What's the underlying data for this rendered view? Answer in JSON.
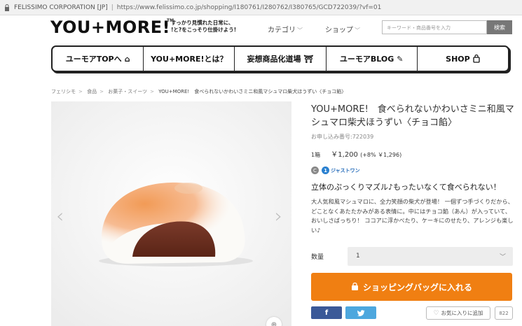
{
  "browser": {
    "site_label": "FELISSIMO CORPORATION [JP]",
    "url": "https://www.felissimo.co.jp/shopping/I180761/I280762/I380765/GCD722039/?vf=01"
  },
  "header": {
    "logo": "YOU+MORE!",
    "logo_tm": "TM",
    "tagline_line1": "すっかり見慣れた日常に、",
    "tagline_line2": "!と?をこっそり仕掛けよう!",
    "category_label": "カテゴリ",
    "shop_label": "ショップ",
    "search_placeholder": "キーワード・商品番号を入力",
    "search_button": "検索"
  },
  "main_nav": {
    "items": [
      {
        "label": "ユーモアTOPへ",
        "icon": "home-icon",
        "glyph": "⌂"
      },
      {
        "label": "YOU+MORE!とは？",
        "icon": "",
        "glyph": ""
      },
      {
        "label": "妄想商品化道場",
        "icon": "dojo-gate-icon",
        "glyph": "⛩"
      },
      {
        "label": "ユーモアBLOG",
        "icon": "pencil-icon",
        "glyph": "✎"
      },
      {
        "label": "SHOP",
        "icon": "shopping-bag-icon",
        "glyph": "🛍"
      }
    ]
  },
  "breadcrumb": {
    "items": [
      "フェリシモ",
      "食品",
      "お菓子・スイーツ"
    ],
    "current": "YOU+MORE!　食べられないかわいさミニ和風マシュマロ柴犬ほうずい〈チョコ餡〉"
  },
  "product": {
    "title": "YOU+MORE!　食べられないかわいさミニ和風マシュマロ柴犬ほうずい〈チョコ餡〉",
    "order_number": "お申し込み番号:722039",
    "quantity_unit": "1箱",
    "price": "￥1,200",
    "price_with_tax": "(+8% ￥1,296)",
    "badge_c": "C",
    "badge_j_label": "ジャストワン",
    "catchphrase": "立体のぷっくりマズル♪もったいなくて食べられない！",
    "description": "大人気和風マシュマロに、全力笑顔の柴犬が登場！ 一個ずつ手づくりだから、どことなくあたたかみがある表情に。中にはチョコ餡（あん）が入っていて、おいしさばっちり！ ココアに浮かべたり、ケーキにのせたり、アレンジも楽しい♪",
    "quantity_label": "数量",
    "quantity_value": "1",
    "cart_button": "ショッピングバッグに入れる",
    "facebook_label": "f",
    "twitter_label": "🐦",
    "favorite_label": "お気に入りに追加",
    "favorite_count": "822"
  }
}
